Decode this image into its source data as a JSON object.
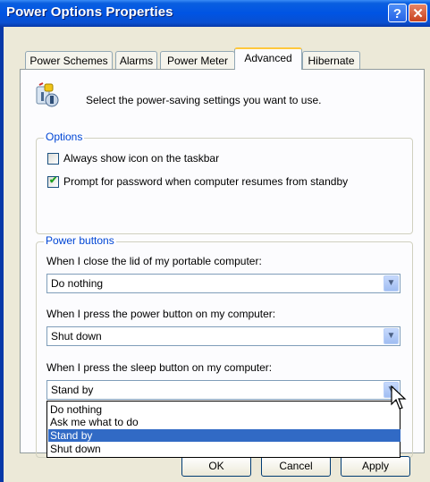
{
  "window": {
    "title": "Power Options Properties",
    "help_glyph": "?",
    "close_glyph": "✕"
  },
  "tabs": [
    {
      "label": "Power Schemes",
      "active": false
    },
    {
      "label": "Alarms",
      "active": false
    },
    {
      "label": "Power Meter",
      "active": false
    },
    {
      "label": "Advanced",
      "active": true
    },
    {
      "label": "Hibernate",
      "active": false
    }
  ],
  "header": {
    "icon": "power-settings-icon",
    "text": "Select the power-saving settings you want to use."
  },
  "options": {
    "legend": "Options",
    "show_icon": {
      "label": "Always show icon on the taskbar",
      "checked": false
    },
    "prompt_password": {
      "label": "Prompt for password when computer resumes from standby",
      "checked": true
    }
  },
  "power_buttons": {
    "legend": "Power buttons",
    "lid": {
      "label": "When I close the lid of my portable computer:",
      "value": "Do nothing"
    },
    "power": {
      "label": "When I press the power button on my computer:",
      "value": "Shut down"
    },
    "sleep": {
      "label": "When I press the sleep button on my computer:",
      "value": "Stand by",
      "options": [
        "Do nothing",
        "Ask me what to do",
        "Stand by",
        "Shut down"
      ],
      "highlighted": "Stand by"
    }
  },
  "buttons": {
    "ok": "OK",
    "cancel": "Cancel",
    "apply": "Apply"
  },
  "colors": {
    "title_bar": "#0054e3",
    "group_legend": "#0046d5",
    "selection": "#316ac5",
    "tab_accent": "#ffc83c"
  }
}
